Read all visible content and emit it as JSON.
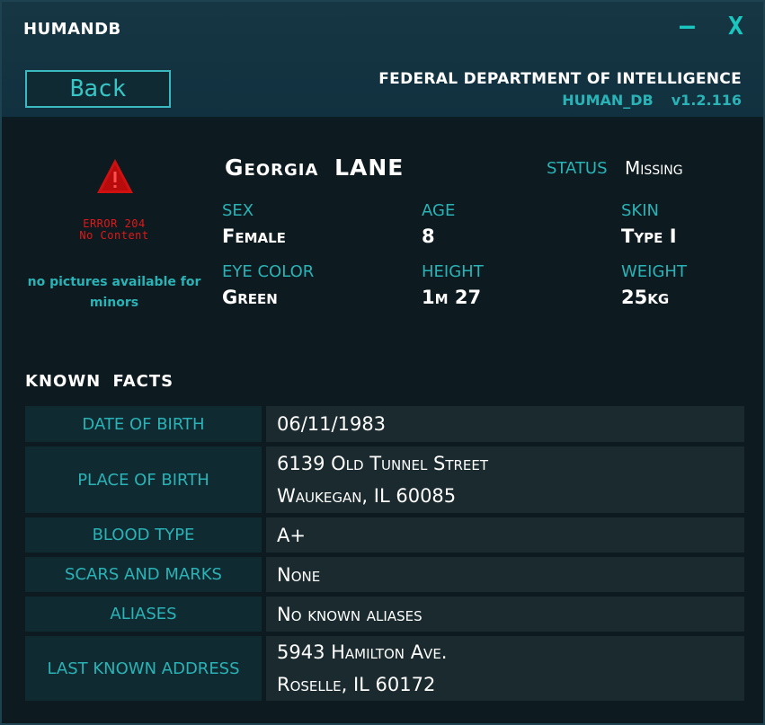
{
  "window": {
    "title": "HUMANDB",
    "minimize_label": "–",
    "close_label": "X"
  },
  "header": {
    "back_label": "Back",
    "agency": "FEDERAL DEPARTMENT OF INTELLIGENCE",
    "db_name": "HUMAN_DB",
    "version": "v1.2.116"
  },
  "photo": {
    "icon": "warning-triangle-icon",
    "error_line1": "ERROR 204",
    "error_line2": "No Content",
    "notice": "no pictures available for minors"
  },
  "person": {
    "first_name": "Georgia",
    "last_name": "LANE",
    "status_label": "STATUS",
    "status_value": "Missing",
    "attributes": [
      {
        "label": "SEX",
        "value": "Female"
      },
      {
        "label": "AGE",
        "value": "8"
      },
      {
        "label": "SKIN",
        "value": "Type I"
      },
      {
        "label": "EYE COLOR",
        "value": "Green"
      },
      {
        "label": "HEIGHT",
        "value": "1m 27"
      },
      {
        "label": "WEIGHT",
        "value": "25kg"
      }
    ]
  },
  "known_facts": {
    "title": "KNOWN FACTS",
    "rows": [
      {
        "label": "DATE OF BIRTH",
        "line1": "06/11/1983",
        "line2": ""
      },
      {
        "label": "PLACE OF BIRTH",
        "line1": "6139 Old Tunnel Street",
        "line2": "Waukegan, IL 60085"
      },
      {
        "label": "BLOOD TYPE",
        "line1": "A+",
        "line2": ""
      },
      {
        "label": "SCARS AND MARKS",
        "line1": "None",
        "line2": ""
      },
      {
        "label": "ALIASES",
        "line1": "No known aliases",
        "line2": ""
      },
      {
        "label": "LAST KNOWN ADDRESS",
        "line1": "5943 Hamilton Ave.",
        "line2": "Roselle, IL 60172"
      }
    ]
  },
  "colors": {
    "accent": "#2ab3b6",
    "error": "#e01818",
    "background": "#0d1a1f"
  }
}
